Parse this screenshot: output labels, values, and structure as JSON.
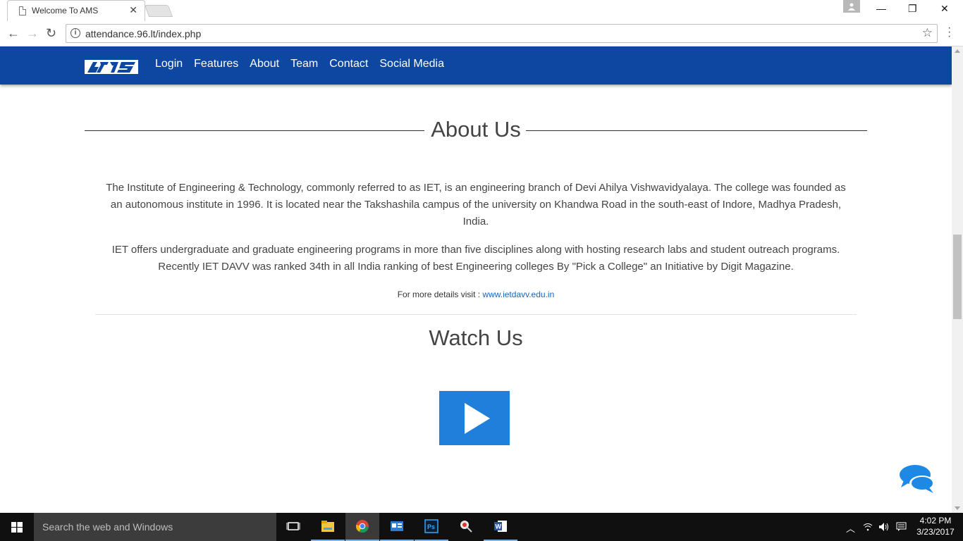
{
  "browser": {
    "tab_title": "Welcome To AMS",
    "tab_close": "✕",
    "url": "attendance.96.lt/index.php",
    "info_glyph": "i",
    "star_glyph": "☆",
    "back_glyph": "←",
    "forward_glyph": "→",
    "reload_glyph": "↻",
    "minimize_glyph": "—",
    "restore_glyph": "❐",
    "close_glyph": "✕"
  },
  "navbar": {
    "bg_color": "#0d47a1",
    "logo_text": "AMS",
    "links": [
      "Login",
      "Features",
      "About",
      "Team",
      "Contact",
      "Social Media"
    ]
  },
  "about": {
    "title": "About Us",
    "para1": "The Institute of Engineering & Technology, commonly referred to as IET, is an engineering branch of Devi Ahilya Vishwavidyalaya. The college was founded as an autonomous institute in 1996. It is located near the Takshashila campus of the university on Khandwa Road in the south-east of Indore, Madhya Pradesh, India.",
    "para2": "IET offers undergraduate and graduate engineering programs in more than five disciplines along with hosting research labs and student outreach programs. Recently IET DAVV was ranked 34th in all India ranking of best Engineering colleges By \"Pick a College\" an Initiative by Digit Magazine.",
    "more_prefix": "For more details visit : ",
    "more_link": "www.ietdavv.edu.in"
  },
  "watch": {
    "title": "Watch Us",
    "play_color": "#1f7fdb"
  },
  "taskbar": {
    "search_placeholder": "Search the web and Windows",
    "time": "4:02 PM",
    "date": "3/23/2017",
    "apps": [
      "task-view-icon",
      "file-explorer-icon",
      "chrome-icon",
      "contacts-icon",
      "photoshop-icon",
      "snipping-icon",
      "word-icon"
    ]
  }
}
